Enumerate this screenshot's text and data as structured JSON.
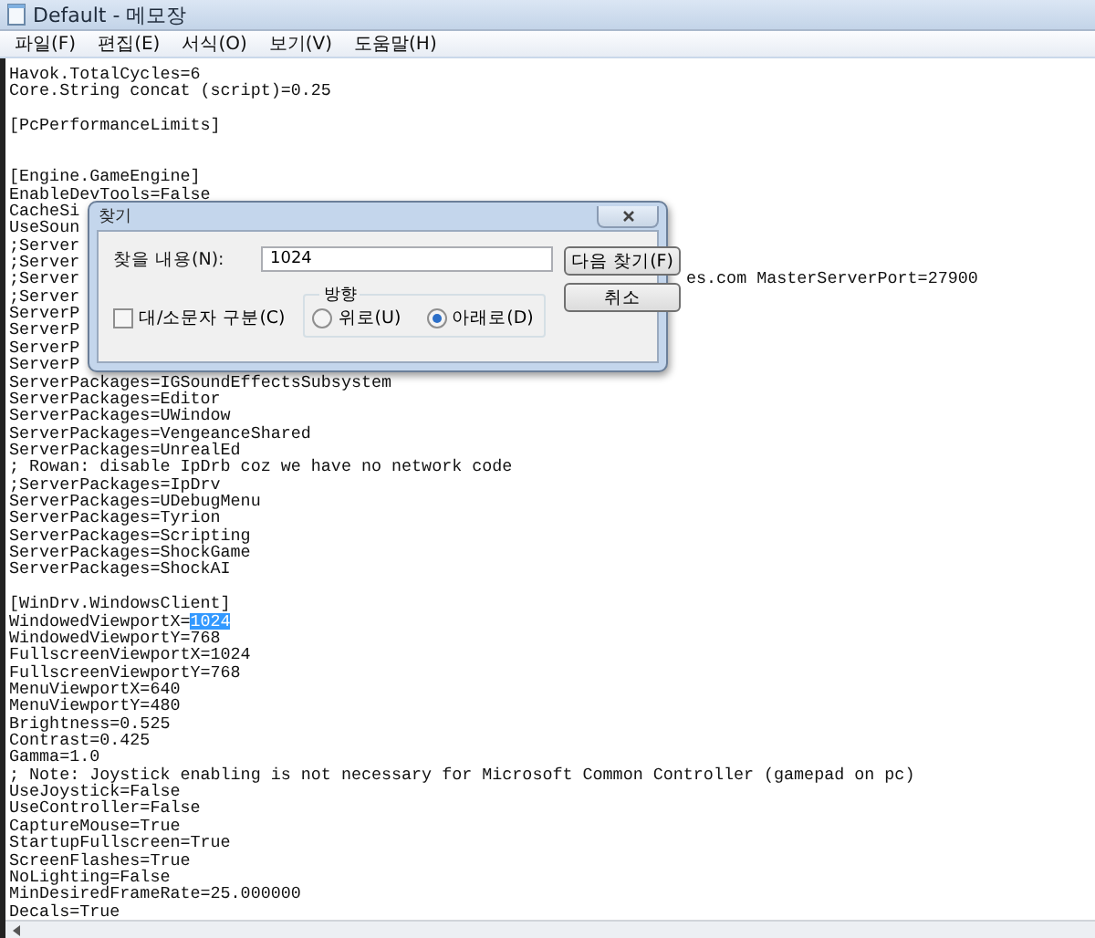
{
  "window": {
    "title": "Default - 메모장"
  },
  "menu": [
    "파일(F)",
    "편집(E)",
    "서식(O)",
    "보기(V)",
    "도움말(H)"
  ],
  "lines": [
    {
      "kind": "text",
      "text": "Havok.TotalCycles=6"
    },
    {
      "kind": "text",
      "text": "Core.String concat (script)=0.25"
    },
    {
      "kind": "blank"
    },
    {
      "kind": "text",
      "text": "[PcPerformanceLimits]"
    },
    {
      "kind": "blank"
    },
    {
      "kind": "blank"
    },
    {
      "kind": "text",
      "text": "[Engine.GameEngine]"
    },
    {
      "kind": "text",
      "text": "EnableDevTools=False"
    },
    {
      "kind": "text",
      "text": "CacheSi"
    },
    {
      "kind": "text",
      "text": "UseSoun"
    },
    {
      "kind": "text",
      "text": ";Server"
    },
    {
      "kind": "text",
      "text": ";Server"
    },
    {
      "kind": "text",
      "text": ";Server",
      "tail": "es.com MasterServerPort=27900"
    },
    {
      "kind": "text",
      "text": ";Server"
    },
    {
      "kind": "text",
      "text": "ServerP"
    },
    {
      "kind": "text",
      "text": "ServerP"
    },
    {
      "kind": "text",
      "text": "ServerP"
    },
    {
      "kind": "text",
      "text": "ServerP"
    },
    {
      "kind": "text",
      "text": "ServerPackages=IGSoundEffectsSubsystem"
    },
    {
      "kind": "text",
      "text": "ServerPackages=Editor"
    },
    {
      "kind": "text",
      "text": "ServerPackages=UWindow"
    },
    {
      "kind": "text",
      "text": "ServerPackages=VengeanceShared"
    },
    {
      "kind": "text",
      "text": "ServerPackages=UnrealEd"
    },
    {
      "kind": "text",
      "text": "; Rowan: disable IpDrb coz we have no network code"
    },
    {
      "kind": "text",
      "text": ";ServerPackages=IpDrv"
    },
    {
      "kind": "text",
      "text": "ServerPackages=UDebugMenu"
    },
    {
      "kind": "text",
      "text": "ServerPackages=Tyrion"
    },
    {
      "kind": "text",
      "text": "ServerPackages=Scripting"
    },
    {
      "kind": "text",
      "text": "ServerPackages=ShockGame"
    },
    {
      "kind": "text",
      "text": "ServerPackages=ShockAI"
    },
    {
      "kind": "blank"
    },
    {
      "kind": "text",
      "text": "[WinDrv.WindowsClient]"
    },
    {
      "kind": "text",
      "text": "WindowedViewportX=",
      "highlight": "1024"
    },
    {
      "kind": "text",
      "text": "WindowedViewportY=768"
    },
    {
      "kind": "text",
      "text": "FullscreenViewportX=1024"
    },
    {
      "kind": "text",
      "text": "FullscreenViewportY=768"
    },
    {
      "kind": "text",
      "text": "MenuViewportX=640"
    },
    {
      "kind": "text",
      "text": "MenuViewportY=480"
    },
    {
      "kind": "text",
      "text": "Brightness=0.525"
    },
    {
      "kind": "text",
      "text": "Contrast=0.425"
    },
    {
      "kind": "text",
      "text": "Gamma=1.0"
    },
    {
      "kind": "text",
      "text": "; Note: Joystick enabling is not necessary for Microsoft Common Controller (gamepad on pc)"
    },
    {
      "kind": "text",
      "text": "UseJoystick=False"
    },
    {
      "kind": "text",
      "text": "UseController=False"
    },
    {
      "kind": "text",
      "text": "CaptureMouse=True"
    },
    {
      "kind": "text",
      "text": "StartupFullscreen=True"
    },
    {
      "kind": "text",
      "text": "ScreenFlashes=True"
    },
    {
      "kind": "text",
      "text": "NoLighting=False"
    },
    {
      "kind": "text",
      "text": "MinDesiredFrameRate=25.000000"
    },
    {
      "kind": "text",
      "text": "Decals=True"
    }
  ],
  "find_dialog": {
    "title": "찾기",
    "find_label": "찾을 내용(N):",
    "find_value": "1024",
    "find_next_button": "다음 찾기(F)",
    "cancel_button": "취소",
    "match_case": {
      "label": "대/소문자 구분(C)",
      "checked": false
    },
    "direction": {
      "label": "방향",
      "options": [
        {
          "label": "위로(U)",
          "selected": false
        },
        {
          "label": "아래로(D)",
          "selected": true
        }
      ]
    }
  }
}
